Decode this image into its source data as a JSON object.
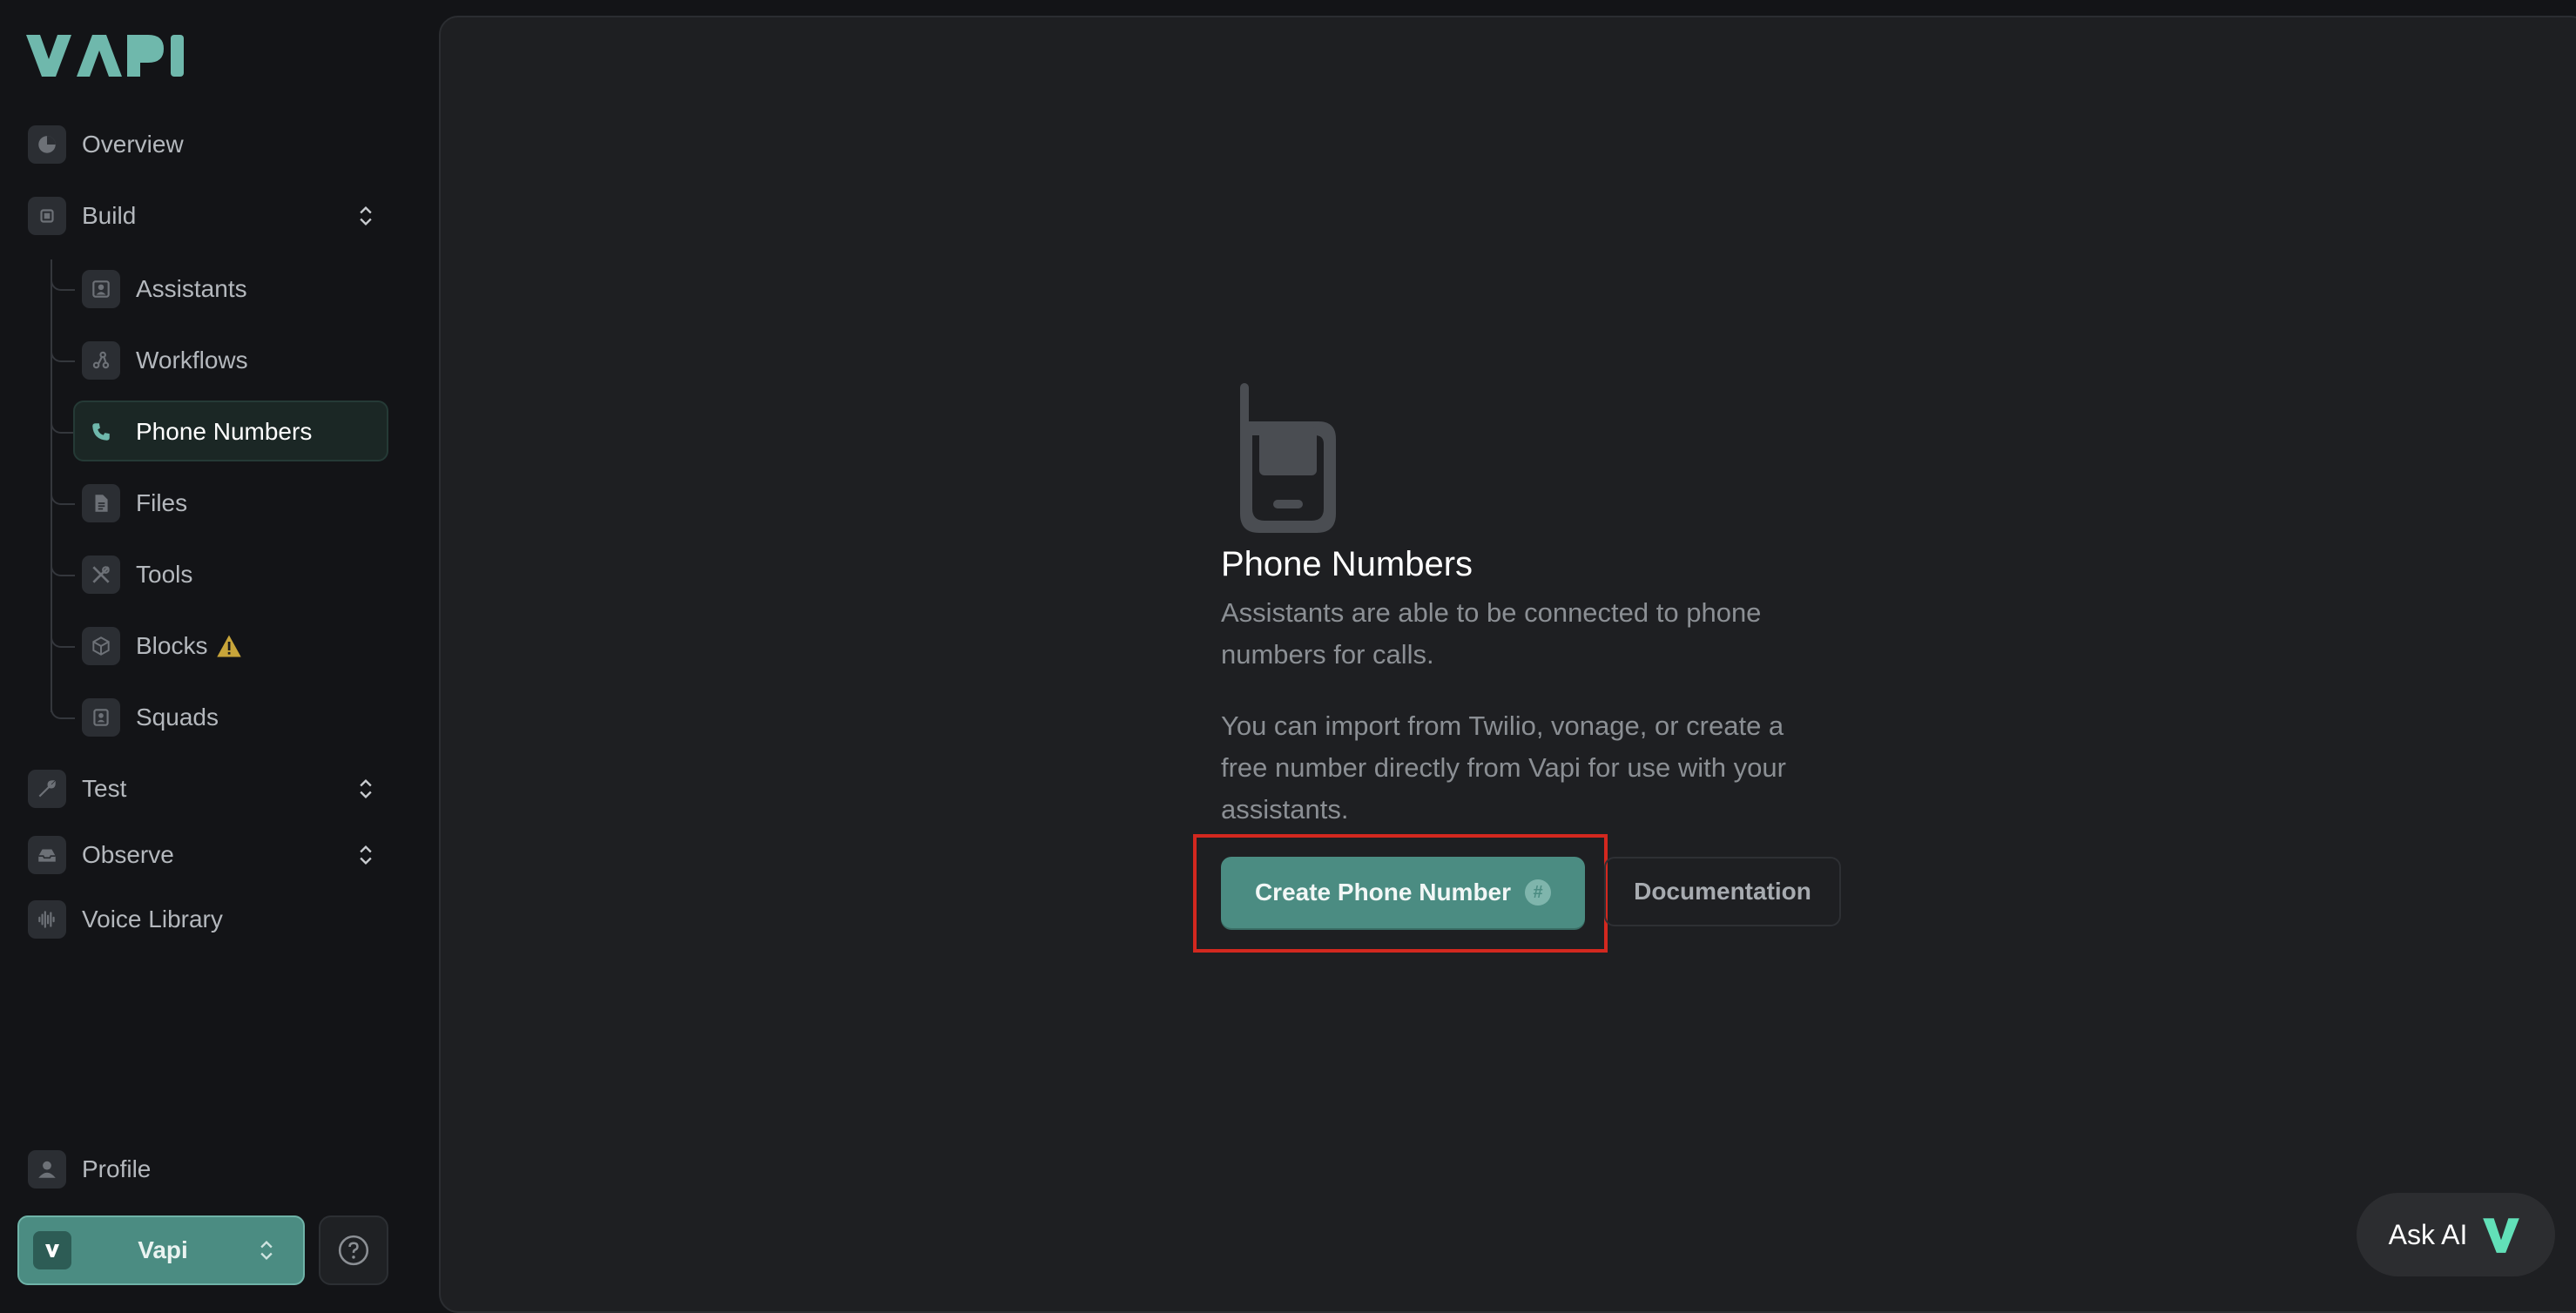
{
  "app": {
    "logo_text": "VAPI"
  },
  "sidebar": {
    "overview": "Overview",
    "build": "Build",
    "build_items": [
      {
        "label": "Assistants",
        "icon": "assistant-icon"
      },
      {
        "label": "Workflows",
        "icon": "workflow-icon"
      },
      {
        "label": "Phone Numbers",
        "icon": "phone-icon",
        "active": true
      },
      {
        "label": "Files",
        "icon": "file-icon"
      },
      {
        "label": "Tools",
        "icon": "tools-icon"
      },
      {
        "label": "Blocks",
        "icon": "blocks-icon",
        "badge": "warning-icon"
      },
      {
        "label": "Squads",
        "icon": "squads-icon"
      }
    ],
    "test": "Test",
    "observe": "Observe",
    "voice_library": "Voice Library",
    "profile": "Profile",
    "org_name": "Vapi"
  },
  "main": {
    "empty_title": "Phone Numbers",
    "empty_desc_1": "Assistants are able to be connected to phone numbers for calls.",
    "empty_desc_2": "You can import from Twilio, vonage, or create a free number directly from Vapi for use with your assistants.",
    "create_label": "Create Phone Number",
    "create_badge": "#",
    "doc_label": "Documentation"
  },
  "ask_ai": {
    "label": "Ask AI"
  },
  "colors": {
    "accent": "#4b8c82",
    "highlight": "#d3281f",
    "logo": "#6fb8ac"
  }
}
